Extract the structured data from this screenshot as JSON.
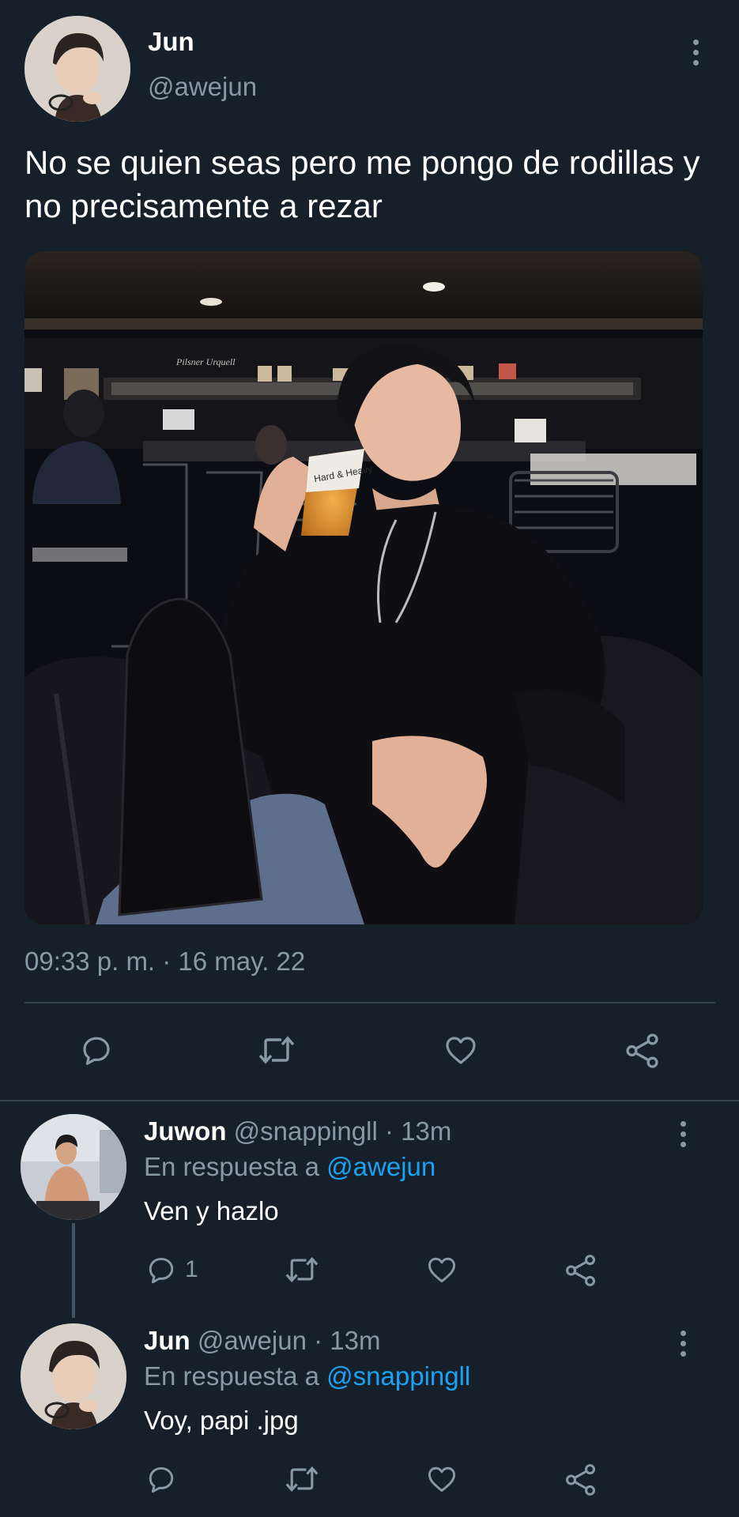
{
  "tweet": {
    "author": {
      "name": "Jun",
      "handle": "@awejun"
    },
    "text": "No se quien seas pero me pongo de rodillas y no precisamente a rezar",
    "photo_text": {
      "cup_brand": "Hard & Heavy",
      "sign": "Pilsner Urquell"
    },
    "timestamp": "09:33 p. m. · 16 may. 22"
  },
  "replies": [
    {
      "name": "Juwon",
      "meta": "@snappingll · 13m",
      "reply_prefix": "En respuesta a",
      "reply_to": "@awejun",
      "text": "Ven y hazlo",
      "reply_count": "1"
    },
    {
      "name": "Jun",
      "meta": "@awejun · 13m",
      "reply_prefix": "En respuesta a",
      "reply_to": "@snappingll",
      "text": "Voy, papi .jpg",
      "reply_count": ""
    }
  ],
  "icons": {
    "reply": "reply-icon",
    "retweet": "retweet-icon",
    "like": "like-icon",
    "share": "share-icon",
    "more": "more-icon"
  },
  "colors": {
    "background": "#15202b",
    "secondary_text": "#8899a6",
    "link": "#1da1f2",
    "divider": "#38444d"
  }
}
